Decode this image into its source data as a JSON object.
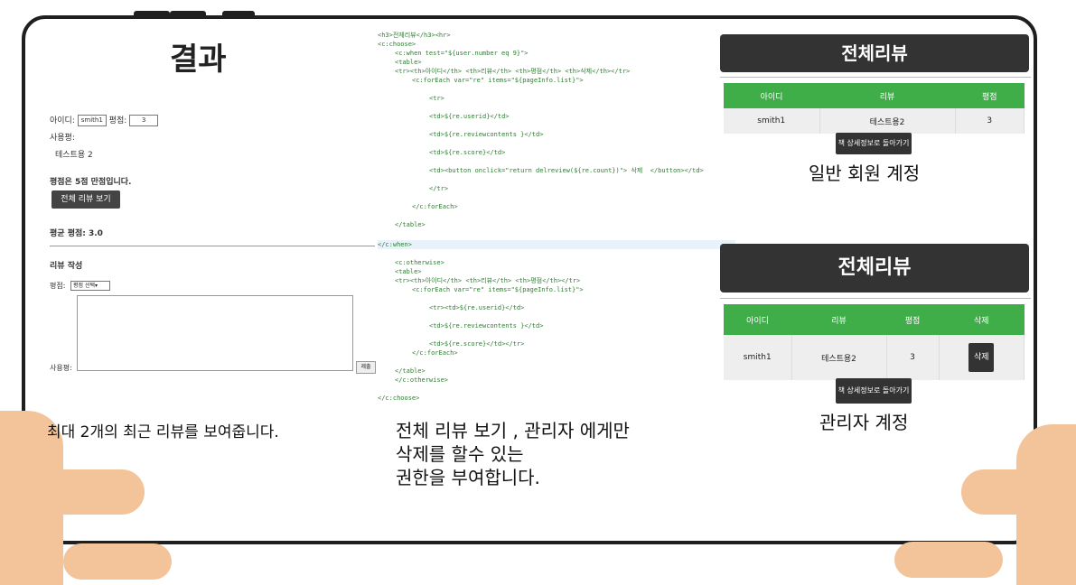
{
  "left": {
    "title": "결과",
    "id_label": "아이디:",
    "id_value": "smith1",
    "score_label": "평점:",
    "score_value": "3",
    "review_label": "사용평:",
    "review_value": "테스트용 2",
    "perfect_note": "평점은 5점 만점입니다.",
    "view_all_button": "전체 리뷰 보기",
    "avg_score": "평균 평점: 3.0",
    "write_heading": "리뷰 작성",
    "score_select_label": "평점:",
    "score_select_value": "평점 선택",
    "textarea_label": "사용평:",
    "submit_button": "제출",
    "caption": "최대 2개의 최근 리뷰를 보여줍니다."
  },
  "code": {
    "lines": [
      {
        "text": "<h3>전체리뷰</h3><hr>",
        "cls": "tg",
        "indent": 0
      },
      {
        "text": "<c:choose>",
        "cls": "tg",
        "indent": 0
      },
      {
        "text": "<c:when test=\"${user.number eq 9}\">",
        "cls": "tg",
        "indent": 1
      },
      {
        "text": "<table>",
        "cls": "tg",
        "indent": 1
      },
      {
        "text": "<tr><th>아이디</th> <th>리뷰</th> <th>평점</th> <th>삭제</th></tr>",
        "cls": "tg",
        "indent": 1
      },
      {
        "text": "<c:forEach var=\"re\" items=\"${pageInfo.list}\">",
        "cls": "tg",
        "indent": 2
      },
      {
        "text": "<tr>",
        "cls": "tg",
        "indent": 3
      },
      {
        "text": "<td>${re.userid}</td>",
        "cls": "tg",
        "indent": 3
      },
      {
        "text": "<td>${re.reviewcontents }</td>",
        "cls": "tg",
        "indent": 3
      },
      {
        "text": "<td>${re.score}</td>",
        "cls": "tg",
        "indent": 3
      },
      {
        "text": "<td><button onclick=\"return delreview(${re.count})\"> 삭제  </button></td>",
        "cls": "tg",
        "indent": 3
      },
      {
        "text": "</tr>",
        "cls": "tg",
        "indent": 3
      },
      {
        "text": "</c:forEach>",
        "cls": "tg",
        "indent": 2
      },
      {
        "text": "</table>",
        "cls": "tg",
        "indent": 1
      },
      {
        "text": "</c:when>",
        "cls": "tg",
        "indent": 0
      },
      {
        "text": "<c:otherwise>",
        "cls": "tg",
        "indent": 1
      },
      {
        "text": "<table>",
        "cls": "tg",
        "indent": 1
      },
      {
        "text": "<tr><th>아이디</th> <th>리뷰</th> <th>평점</th></tr>",
        "cls": "tg",
        "indent": 1
      },
      {
        "text": "<c:forEach var=\"re\" items=\"${pageInfo.list}\">",
        "cls": "tg",
        "indent": 2
      },
      {
        "text": "<tr><td>${re.userid}</td>",
        "cls": "tg",
        "indent": 3
      },
      {
        "text": "<td>${re.reviewcontents }</td>",
        "cls": "tg",
        "indent": 3
      },
      {
        "text": "<td>${re.score}</td></tr>",
        "cls": "tg",
        "indent": 3
      },
      {
        "text": "</c:forEach>",
        "cls": "tg",
        "indent": 2
      },
      {
        "text": "</table>",
        "cls": "tg",
        "indent": 1
      },
      {
        "text": "</c:otherwise>",
        "cls": "tg",
        "indent": 1
      },
      {
        "text": "</c:choose>",
        "cls": "tg",
        "indent": 0
      }
    ],
    "caption_lines": [
      "전체 리뷰 보기 , 관리자 에게만",
      "삭제를 할수 있는",
      "권한을 부여합니다."
    ]
  },
  "right": {
    "user_view": {
      "title": "전체리뷰",
      "headers": [
        "아이디",
        "리뷰",
        "평점"
      ],
      "row": [
        "smith1",
        "테스트용2",
        "3"
      ],
      "back_button": "책 상세정보로 돌아가기",
      "label": "일반 회원 계정"
    },
    "admin_view": {
      "title": "전체리뷰",
      "headers": [
        "아이디",
        "리뷰",
        "평점",
        "삭제"
      ],
      "row": [
        "smith1",
        "테스트용2",
        "3"
      ],
      "delete_button": "삭제",
      "back_button": "책 상세정보로 돌아가기",
      "label": "관리자 계정"
    }
  },
  "colors": {
    "table_header": "#3fae49",
    "dark_button": "#333333",
    "hand": "#f3c39a"
  }
}
